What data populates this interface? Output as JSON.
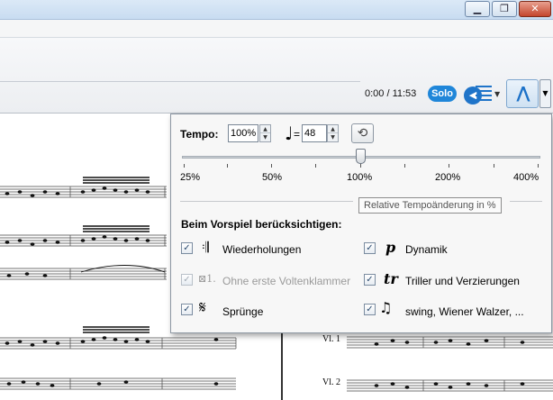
{
  "window": {
    "minimize_glyph": "▁",
    "restore_glyph": "❐",
    "close_glyph": "✕"
  },
  "toolbar": {
    "time_counter": "0:00 / 11:53",
    "solo_label": "Solo",
    "dropdown_glyph": "▼"
  },
  "score": {
    "staff_labels": [
      "Vl. 1",
      "Vl. 2"
    ]
  },
  "tempo_panel": {
    "tempo_label": "Tempo:",
    "tempo_value": "100%",
    "bpm_equals": "=",
    "bpm_value": "48",
    "slider_value_percent": 100,
    "slider_ticks": [
      "25%",
      "50%",
      "100%",
      "200%",
      "400%"
    ],
    "tooltip": "Relative Tempoänderung in %",
    "section_title": "Beim Vorspiel berücksichtigen:",
    "options": [
      {
        "label": "Wiederholungen",
        "checked": true,
        "enabled": true,
        "icon": "repeat-barline-icon"
      },
      {
        "label": "Dynamik",
        "checked": true,
        "enabled": true,
        "icon": "dynamics-p-icon"
      },
      {
        "label": "Ohne erste Voltenklammer",
        "checked": true,
        "enabled": false,
        "icon": "volta-bracket-icon"
      },
      {
        "label": "Triller und Verzierungen",
        "checked": true,
        "enabled": true,
        "icon": "trill-icon"
      },
      {
        "label": "Sprünge",
        "checked": true,
        "enabled": true,
        "icon": "segno-icon"
      },
      {
        "label": "swing, Wiener Walzer, ...",
        "checked": true,
        "enabled": true,
        "icon": "triplet-notes-icon"
      }
    ]
  }
}
